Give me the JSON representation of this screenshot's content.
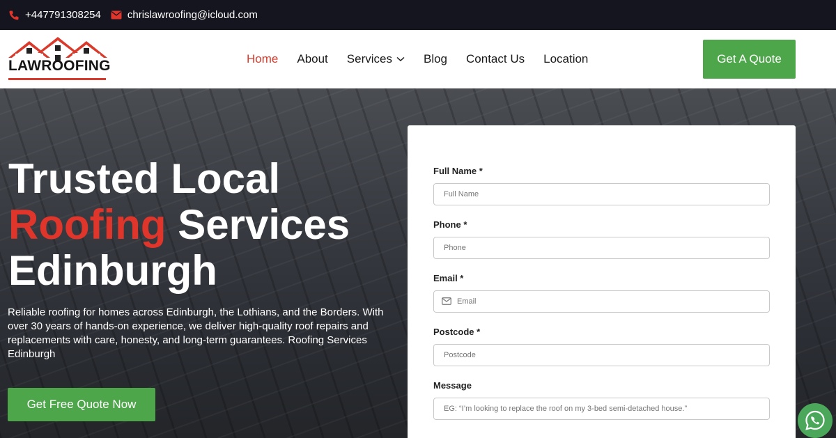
{
  "topbar": {
    "phone": "+447791308254",
    "email": "chrislawroofing@icloud.com",
    "phone_icon": "phone-icon",
    "email_icon": "envelope-icon"
  },
  "header": {
    "logo_text": "LAWROOFING",
    "nav": [
      {
        "label": "Home",
        "active": true
      },
      {
        "label": "About"
      },
      {
        "label": "Services",
        "has_dropdown": true
      },
      {
        "label": "Blog"
      },
      {
        "label": "Contact Us"
      },
      {
        "label": "Location"
      }
    ],
    "quote_button": "Get A Quote"
  },
  "hero": {
    "title_line1": "Trusted Local",
    "title_red": "Roofing",
    "title_line2_rest": " Services",
    "title_line3": "Edinburgh",
    "description": "Reliable roofing for homes across Edinburgh, the Lothians, and the Borders. With over 30 years of hands-on experience, we deliver high-quality roof repairs and replacements with care, honesty, and long-term guarantees. Roofing Services Edinburgh",
    "cta": "Get Free Quote Now"
  },
  "form": {
    "fields": [
      {
        "label": "Full Name *",
        "placeholder": "Full Name"
      },
      {
        "label": "Phone *",
        "placeholder": "Phone"
      },
      {
        "label": "Email *",
        "placeholder": "Email"
      },
      {
        "label": "Postcode *",
        "placeholder": "Postcode"
      },
      {
        "label": "Message",
        "placeholder": "EG: “I’m looking to replace the roof on my 3-bed semi-detached house.”"
      }
    ]
  },
  "colors": {
    "accent_red": "#e0352b",
    "button_green": "#4ea64a",
    "topbar_bg": "#15151f"
  }
}
